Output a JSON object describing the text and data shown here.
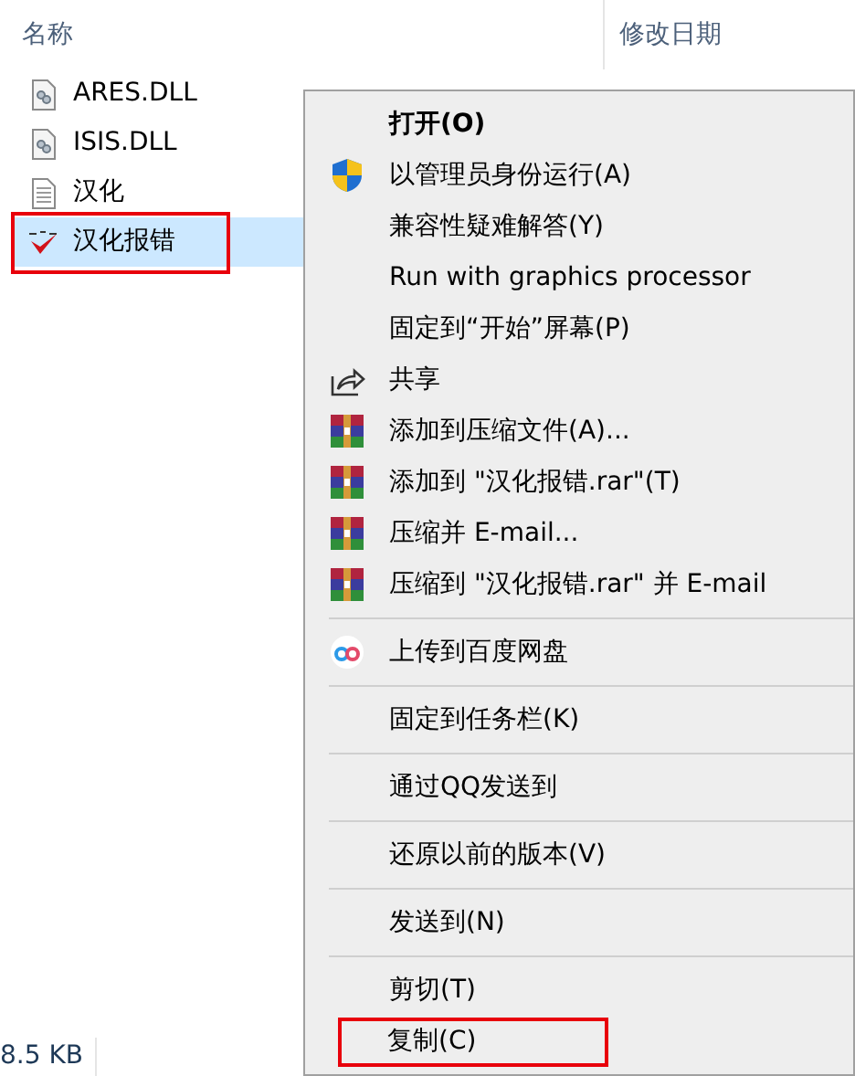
{
  "columns": [
    {
      "label": "名称"
    },
    {
      "label": "修改日期"
    }
  ],
  "files": [
    {
      "name": "ARES.DLL",
      "kind": "dll",
      "selected": false,
      "annotated": false
    },
    {
      "name": "ISIS.DLL",
      "kind": "dll",
      "selected": false,
      "annotated": false
    },
    {
      "name": "汉化",
      "kind": "text",
      "selected": false,
      "annotated": false
    },
    {
      "name": "汉化报错",
      "kind": "check",
      "selected": true,
      "annotated": true
    }
  ],
  "context_menu": {
    "items": [
      {
        "kind": "item",
        "label": "打开(O)",
        "bold": true,
        "annotated": false
      },
      {
        "kind": "shield",
        "label": "以管理员身份运行(A)",
        "annotated": false
      },
      {
        "kind": "item",
        "label": "兼容性疑难解答(Y)",
        "annotated": false
      },
      {
        "kind": "item",
        "label": "Run with graphics processor",
        "annotated": false
      },
      {
        "kind": "item",
        "label": "固定到“开始”屏幕(P)",
        "annotated": false
      },
      {
        "kind": "share",
        "label": "共享",
        "annotated": false
      },
      {
        "kind": "archive",
        "label": "添加到压缩文件(A)...",
        "annotated": false
      },
      {
        "kind": "archive",
        "label": "添加到 \"汉化报错.rar\"(T)",
        "annotated": false
      },
      {
        "kind": "archive",
        "label": "压缩并 E-mail...",
        "annotated": false
      },
      {
        "kind": "archive",
        "label": "压缩到 \"汉化报错.rar\" 并 E-mail",
        "annotated": false
      },
      {
        "kind": "separator"
      },
      {
        "kind": "cloud",
        "label": "上传到百度网盘",
        "annotated": false
      },
      {
        "kind": "separator"
      },
      {
        "kind": "item",
        "label": "固定到任务栏(K)",
        "annotated": false
      },
      {
        "kind": "separator"
      },
      {
        "kind": "item",
        "label": "通过QQ发送到",
        "annotated": false
      },
      {
        "kind": "separator"
      },
      {
        "kind": "item",
        "label": "还原以前的版本(V)",
        "annotated": false
      },
      {
        "kind": "separator"
      },
      {
        "kind": "item",
        "label": "发送到(N)",
        "annotated": false
      },
      {
        "kind": "separator"
      },
      {
        "kind": "item",
        "label": "剪切(T)",
        "annotated": false
      },
      {
        "kind": "item",
        "label": "复制(C)",
        "annotated": true
      }
    ]
  },
  "status_bar": {
    "size": "8.5 KB"
  }
}
